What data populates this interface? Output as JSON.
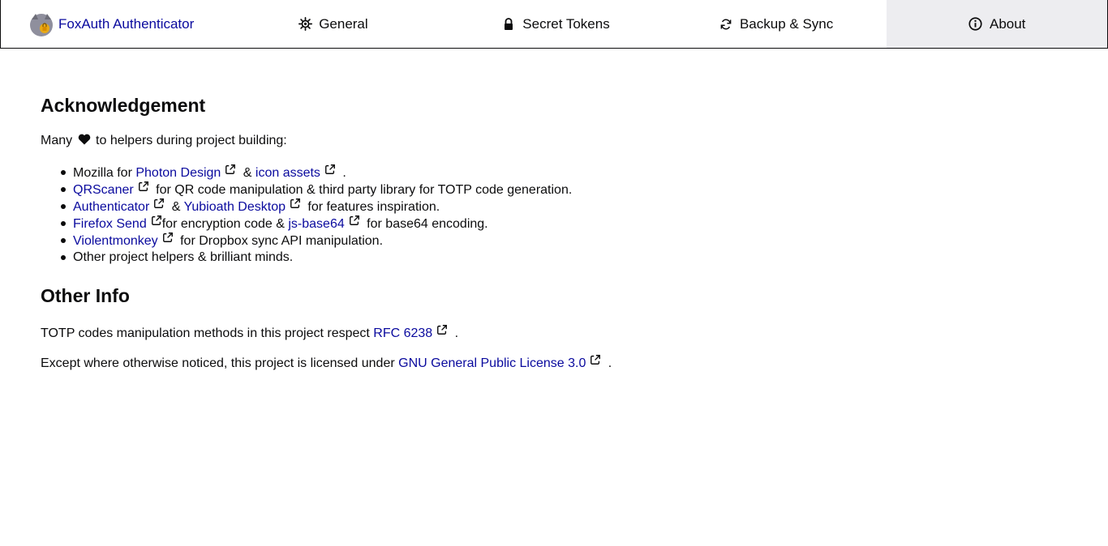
{
  "header": {
    "brand_name": "FoxAuth Authenticator",
    "tabs": [
      {
        "label": "General",
        "icon": "gear-icon"
      },
      {
        "label": "Secret Tokens",
        "icon": "lock-icon"
      },
      {
        "label": "Backup & Sync",
        "icon": "sync-icon"
      },
      {
        "label": "About",
        "icon": "info-icon",
        "active": true
      }
    ]
  },
  "acknowledgement": {
    "heading": "Acknowledgement",
    "intro_before": "Many",
    "intro_after": "to helpers during project building:",
    "items": [
      {
        "t1": "Mozilla for ",
        "link1": "Photon Design",
        "t2": " & ",
        "link2": "icon assets",
        "t3": " ."
      },
      {
        "link1": "QRScaner",
        "t2": " for QR code manipulation & third party library for TOTP code generation."
      },
      {
        "link1": "Authenticator",
        "t2": " & ",
        "link2": "Yubioath Desktop",
        "t3": " for features inspiration."
      },
      {
        "link1": "Firefox Send",
        "t2": "for encryption code & ",
        "link2": "js-base64",
        "t3": " for base64 encoding."
      },
      {
        "link1": "Violentmonkey",
        "t2": " for Dropbox sync API manipulation."
      },
      {
        "text": "Other project helpers & brilliant minds."
      }
    ]
  },
  "other_info": {
    "heading": "Other Info",
    "rfc_before": "TOTP codes manipulation methods in this project respect ",
    "rfc_link": "RFC 6238",
    "rfc_after": " .",
    "license_before": "Except where otherwise noticed, this project is licensed under ",
    "license_link": "GNU General Public License 3.0",
    "license_after": " ."
  },
  "colors": {
    "link": "#0a0a9e",
    "active_tab_bg": "#ededf0",
    "text": "#0c0c0d"
  }
}
